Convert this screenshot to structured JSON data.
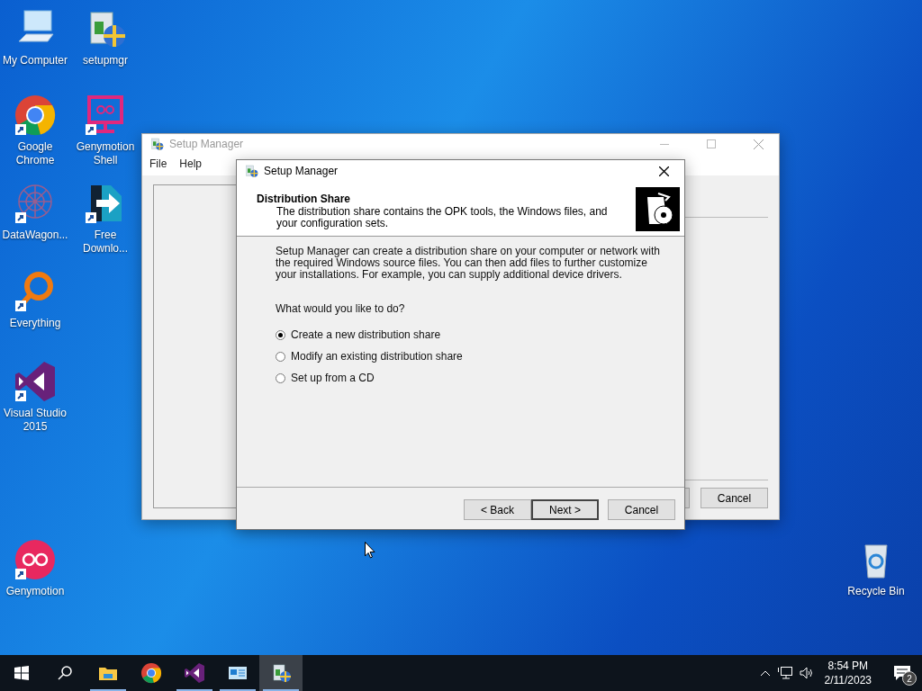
{
  "desktop_icons": [
    {
      "label": "My Computer",
      "kind": "computer"
    },
    {
      "label": "setupmgr",
      "kind": "installer"
    },
    {
      "label": "Google Chrome",
      "kind": "chrome"
    },
    {
      "label": "Genymotion Shell",
      "kind": "monitor"
    },
    {
      "label": "DataWagon...",
      "kind": "pattern"
    },
    {
      "label": "Free Downlo...",
      "kind": "download"
    },
    {
      "label": "Everything",
      "kind": "magnifier"
    },
    {
      "label": "Visual Studio 2015",
      "kind": "vs"
    },
    {
      "label": "Genymotion",
      "kind": "geny"
    },
    {
      "label": "Recycle Bin",
      "kind": "bin"
    }
  ],
  "back_window": {
    "title": "Setup Manager",
    "menu": [
      "File",
      "Help"
    ],
    "buttons": [
      "Cancel"
    ]
  },
  "dialog": {
    "title": "Setup Manager",
    "heading": "Distribution Share",
    "description": "The distribution share contains the OPK tools,  the Windows files, and your configuration sets.",
    "intro": "Setup Manager can create a distribution share on your computer or network with the required Windows source files. You can then add files to further customize your installations. For example, you can supply additional device drivers.",
    "question": "What would you like to do?",
    "options": [
      {
        "label": "Create a new distribution share",
        "selected": true
      },
      {
        "label": "Modify an existing distribution share",
        "selected": false
      },
      {
        "label": "Set up from a CD",
        "selected": false
      }
    ],
    "buttons": [
      {
        "label": "< Back",
        "default": false
      },
      {
        "label": "Next >",
        "default": true
      },
      {
        "label": "Cancel",
        "default": false
      }
    ]
  },
  "taskbar": {
    "apps": [
      {
        "kind": "explorer",
        "running": true,
        "selected": false
      },
      {
        "kind": "chrome",
        "running": false,
        "selected": false
      },
      {
        "kind": "vs",
        "running": true,
        "selected": false
      },
      {
        "kind": "app",
        "running": true,
        "selected": false
      },
      {
        "kind": "installer",
        "running": true,
        "selected": true
      }
    ],
    "time": "8:54 PM",
    "date": "2/11/2023",
    "notifications": "2"
  }
}
